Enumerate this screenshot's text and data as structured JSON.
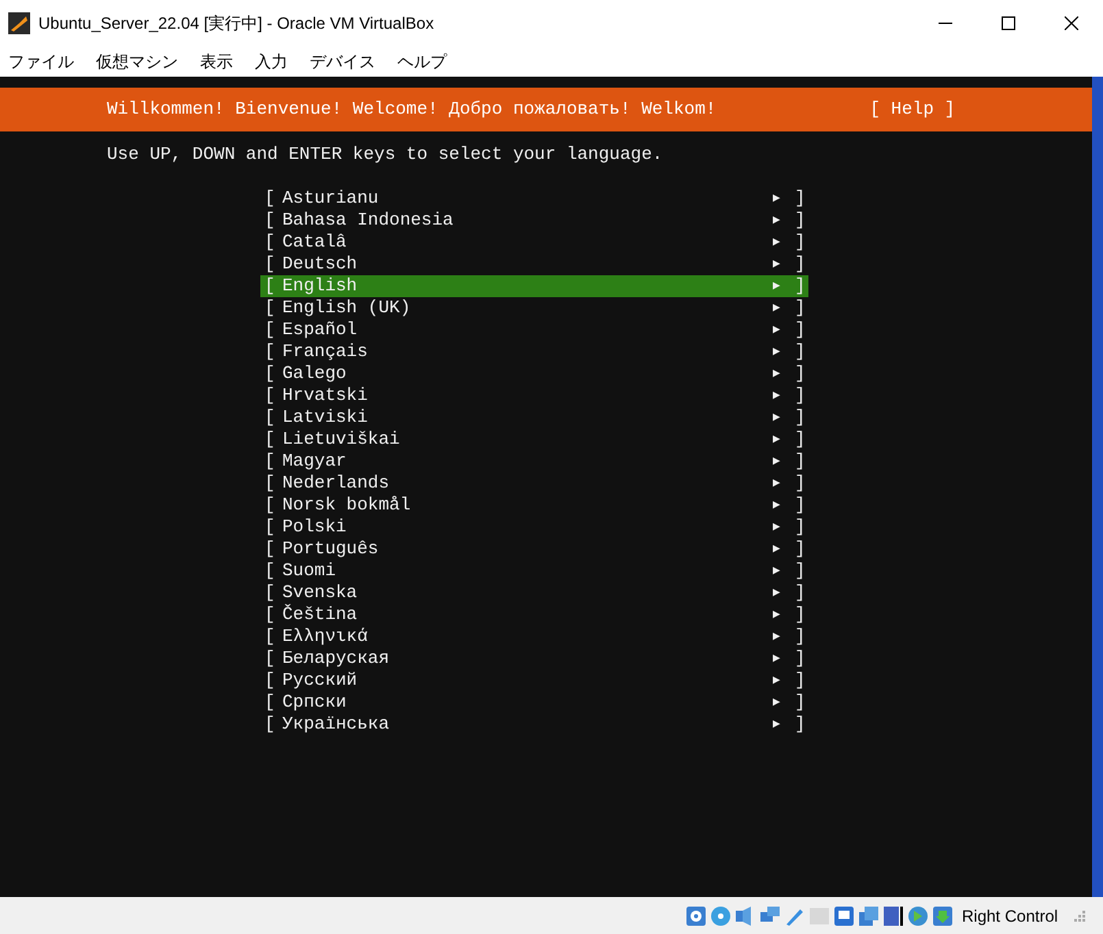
{
  "window": {
    "title": "Ubuntu_Server_22.04 [実行中] - Oracle VM VirtualBox"
  },
  "menu": [
    "ファイル",
    "仮想マシン",
    "表示",
    "入力",
    "デバイス",
    "ヘルプ"
  ],
  "installer": {
    "header": "Willkommen! Bienvenue! Welcome! Добро пожаловать! Welkom!",
    "help": "[ Help ]",
    "instruction": "Use UP, DOWN and ENTER keys to select your language.",
    "languages": [
      {
        "open": "[",
        "label": "Asturianu",
        "arrow": "▶",
        "close": "]",
        "selected": false
      },
      {
        "open": "[",
        "label": "Bahasa Indonesia",
        "arrow": "▶",
        "close": "]",
        "selected": false
      },
      {
        "open": "[",
        "label": "Catalâ",
        "arrow": "▶",
        "close": "]",
        "selected": false
      },
      {
        "open": "[",
        "label": "Deutsch",
        "arrow": "▶",
        "close": "]",
        "selected": false
      },
      {
        "open": "[",
        "label": "English",
        "arrow": "▶",
        "close": "]",
        "selected": true
      },
      {
        "open": "[",
        "label": "English (UK)",
        "arrow": "▶",
        "close": "]",
        "selected": false
      },
      {
        "open": "[",
        "label": "Español",
        "arrow": "▶",
        "close": "]",
        "selected": false
      },
      {
        "open": "[",
        "label": "Français",
        "arrow": "▶",
        "close": "]",
        "selected": false
      },
      {
        "open": "[",
        "label": "Galego",
        "arrow": "▶",
        "close": "]",
        "selected": false
      },
      {
        "open": "[",
        "label": "Hrvatski",
        "arrow": "▶",
        "close": "]",
        "selected": false
      },
      {
        "open": "[",
        "label": "Latviski",
        "arrow": "▶",
        "close": "]",
        "selected": false
      },
      {
        "open": "[",
        "label": "Lietuviškai",
        "arrow": "▶",
        "close": "]",
        "selected": false
      },
      {
        "open": "[",
        "label": "Magyar",
        "arrow": "▶",
        "close": "]",
        "selected": false
      },
      {
        "open": "[",
        "label": "Nederlands",
        "arrow": "▶",
        "close": "]",
        "selected": false
      },
      {
        "open": "[",
        "label": "Norsk bokmål",
        "arrow": "▶",
        "close": "]",
        "selected": false
      },
      {
        "open": "[",
        "label": "Polski",
        "arrow": "▶",
        "close": "]",
        "selected": false
      },
      {
        "open": "[",
        "label": "Português",
        "arrow": "▶",
        "close": "]",
        "selected": false
      },
      {
        "open": "[",
        "label": "Suomi",
        "arrow": "▶",
        "close": "]",
        "selected": false
      },
      {
        "open": "[",
        "label": "Svenska",
        "arrow": "▶",
        "close": "]",
        "selected": false
      },
      {
        "open": "[",
        "label": "Čeština",
        "arrow": "▶",
        "close": "]",
        "selected": false
      },
      {
        "open": "[",
        "label": "Ελληνικά",
        "arrow": "▶",
        "close": "]",
        "selected": false
      },
      {
        "open": "[",
        "label": "Беларуская",
        "arrow": "▶",
        "close": "]",
        "selected": false
      },
      {
        "open": "[",
        "label": "Русский",
        "arrow": "▶",
        "close": "]",
        "selected": false
      },
      {
        "open": "[",
        "label": "Српски",
        "arrow": "▶",
        "close": "]",
        "selected": false
      },
      {
        "open": "[",
        "label": "Українська",
        "arrow": "▶",
        "close": "]",
        "selected": false
      }
    ]
  },
  "status_bar": {
    "host_key": "Right Control"
  }
}
